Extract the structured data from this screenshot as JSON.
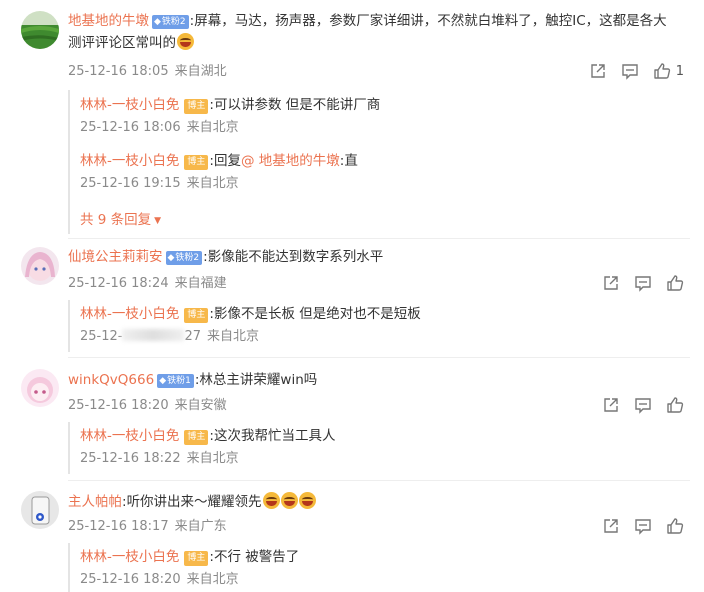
{
  "comments": [
    {
      "user": "地基地的牛墩",
      "fan_badge": "铁粉2",
      "text": "屏幕，马达，扬声器，参数厂家详细讲，不然就白堆料了，触控IC，这都是各大测评评论区常叫的",
      "time": "25-12-16 18:05",
      "location": "来自湖北",
      "like_count": "1",
      "avatar_icon": "green-field-avatar",
      "replies": [
        {
          "user": "林林-一枝小白免",
          "badge": "博主",
          "text": "可以讲参数 但是不能讲厂商",
          "time": "25-12-16 18:06",
          "location": "来自北京"
        },
        {
          "user": "林林-一枝小白免",
          "badge": "博主",
          "prefix": "回复",
          "mention": "@ 地基地的牛墩",
          "text": "直",
          "time": "25-12-16 19:15",
          "location": "来自北京"
        }
      ],
      "more_replies": "共 9 条回复"
    },
    {
      "user": "仙境公主莉莉安",
      "fan_badge": "铁粉2",
      "text": "影像能不能达到数字系列水平",
      "time": "25-12-16 18:24",
      "location": "来自福建",
      "avatar_icon": "anime-girl-avatar",
      "replies": [
        {
          "user": "林林-一枝小白免",
          "badge": "博主",
          "text": "影像不是长板 但是绝对也不是短板",
          "time_start": "25-12-",
          "time_end": "27",
          "location": "来自北京"
        }
      ]
    },
    {
      "user": "winkQvQ666",
      "fan_badge": "铁粉1",
      "text": "林总主讲荣耀win吗",
      "time": "25-12-16 18:20",
      "location": "来自安徽",
      "avatar_icon": "pink-anime-avatar",
      "replies": [
        {
          "user": "林林-一枝小白免",
          "badge": "博主",
          "text": "这次我帮忙当工具人",
          "time": "25-12-16 18:22",
          "location": "来自北京"
        }
      ]
    },
    {
      "user": "主人帕帕",
      "text": "听你讲出来～耀耀领先",
      "time": "25-12-16 18:17",
      "location": "来自广东",
      "avatar_icon": "phone-avatar",
      "replies": [
        {
          "user": "林林-一枝小白免",
          "badge": "博主",
          "text": "不行 被警告了",
          "time": "25-12-16 18:20",
          "location": "来自北京"
        }
      ]
    }
  ],
  "colors": {
    "username": "#eb7350",
    "meta": "#8a8a8a",
    "fan_badge": "#6f9ee8",
    "host_badge": "#f7b84a"
  },
  "icons": {
    "share": "share-icon",
    "comment": "comment-icon",
    "like": "thumbs-up-icon",
    "emoji": "grin-emoji-icon",
    "caret": "caret-down-icon"
  }
}
